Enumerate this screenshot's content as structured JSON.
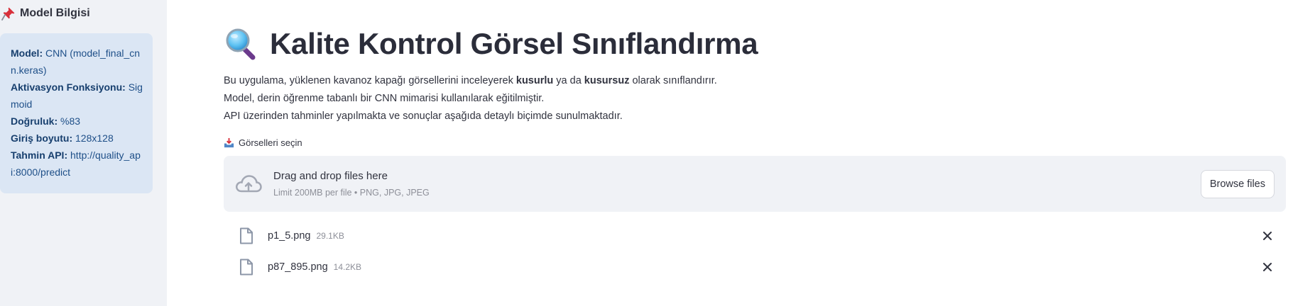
{
  "sidebar": {
    "header": "Model Bilgisi",
    "info": [
      {
        "key": "Model:",
        "value": "CNN (model_final_cnn.keras)"
      },
      {
        "key": "Aktivasyon Fonksiyonu:",
        "value": "Sigmoid"
      },
      {
        "key": "Doğruluk:",
        "value": "%83"
      },
      {
        "key": "Giriş boyutu:",
        "value": "128x128"
      },
      {
        "key": "Tahmin API:",
        "value": "http://quality_api:8000/predict"
      }
    ]
  },
  "main": {
    "title": "Kalite Kontrol Görsel Sınıflandırma",
    "desc": {
      "line1_a": "Bu uygulama, yüklenen kavanoz kapağı görsellerini inceleyerek ",
      "line1_b": "kusurlu",
      "line1_c": " ya da ",
      "line1_d": "kusursuz",
      "line1_e": " olarak sınıflandırır.",
      "line2": "Model, derin öğrenme tabanlı bir CNN mimarisi kullanılarak eğitilmiştir.",
      "line3": "API üzerinden tahminler yapılmakta ve sonuçlar aşağıda detaylı biçimde sunulmaktadır."
    },
    "uploader": {
      "label": "Görselleri seçin",
      "drop_text": "Drag and drop files here",
      "limit_text": "Limit 200MB per file • PNG, JPG, JPEG",
      "browse_label": "Browse files"
    },
    "files": [
      {
        "name": "p1_5.png",
        "size": "29.1KB"
      },
      {
        "name": "p87_895.png",
        "size": "14.2KB"
      }
    ]
  },
  "colors": {
    "sidebar_bg": "#f0f2f6",
    "info_bg": "#dbe6f4",
    "info_text": "#1e4f88",
    "dropzone_bg": "#f0f2f6"
  }
}
